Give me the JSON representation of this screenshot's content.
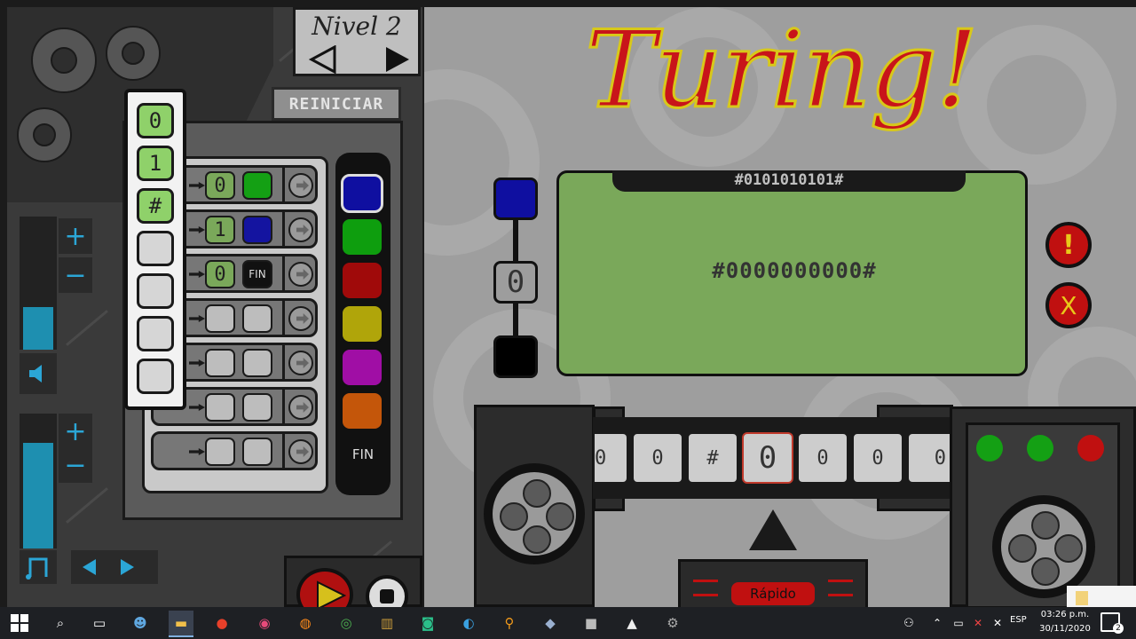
{
  "level": {
    "label": "Nivel 2"
  },
  "controls": {
    "reset_label": "REINICIAR",
    "plus": "+",
    "minus": "−",
    "volume_level": 0.32,
    "speed_level": 0.78
  },
  "symbols": [
    "0",
    "1",
    "#",
    "",
    "",
    "",
    ""
  ],
  "rules": [
    {
      "write": "0",
      "color": "#14a014",
      "end": ""
    },
    {
      "write": "1",
      "color": "#1414a0",
      "end": ""
    },
    {
      "write": "0",
      "color": "#111111",
      "end": "FIN"
    },
    {
      "write": "",
      "color": "",
      "end": ""
    },
    {
      "write": "",
      "color": "",
      "end": ""
    },
    {
      "write": "",
      "color": "",
      "end": ""
    },
    {
      "write": "",
      "color": "",
      "end": ""
    }
  ],
  "palette": {
    "colors": [
      "#0f0fa0",
      "#0e9e0e",
      "#a00a0a",
      "#b0a50a",
      "#a00ea5",
      "#c4560a"
    ],
    "fin_label": "FIN"
  },
  "title": "Turing!",
  "screen": {
    "target": "#0101010101#",
    "current": "#0000000000#"
  },
  "state": {
    "top_color": "#0f0fa0",
    "symbol": "0",
    "bottom_color": "#000000"
  },
  "side_buttons": {
    "alert": "!",
    "close": "X"
  },
  "tape": {
    "cells": [
      "0",
      "0",
      "#",
      "0",
      "0",
      "0",
      "0"
    ],
    "head_index": 3
  },
  "speed": {
    "label": "Rápido"
  },
  "lights": [
    "#14a014",
    "#14a014",
    "#c01010"
  ],
  "taskbar": {
    "language": "ESP",
    "time": "03:26 p.m.",
    "date": "30/11/2020",
    "notifications": "2"
  }
}
